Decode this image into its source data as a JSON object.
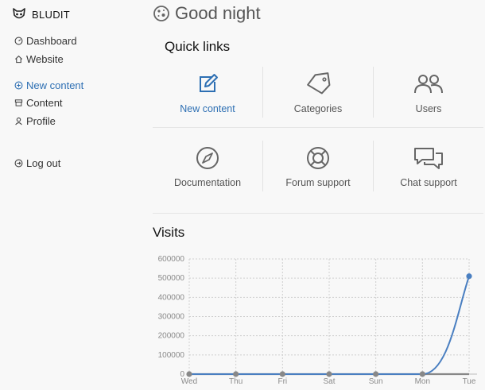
{
  "brand": {
    "name": "BLUDIT",
    "logo_icon": "bludit-logo-icon"
  },
  "sidebar": {
    "items": [
      {
        "label": "Dashboard",
        "icon": "speedometer-icon"
      },
      {
        "label": "Website",
        "icon": "home-icon"
      },
      {
        "label": "New content",
        "icon": "plus-circle-icon",
        "active": true
      },
      {
        "label": "Content",
        "icon": "archive-icon"
      },
      {
        "label": "Profile",
        "icon": "person-icon"
      },
      {
        "label": "Log out",
        "icon": "logout-icon"
      }
    ]
  },
  "greeting": {
    "text": "Good night",
    "icon": "moon-icon"
  },
  "quick_links": {
    "title": "Quick links",
    "items": [
      {
        "label": "New content",
        "icon": "pencil-square-icon"
      },
      {
        "label": "Categories",
        "icon": "tag-icon"
      },
      {
        "label": "Users",
        "icon": "users-icon"
      },
      {
        "label": "Documentation",
        "icon": "compass-icon"
      },
      {
        "label": "Forum support",
        "icon": "lifebuoy-icon"
      },
      {
        "label": "Chat support",
        "icon": "chat-icon"
      }
    ]
  },
  "visits": {
    "title": "Visits"
  },
  "colors": {
    "accent": "#2d6fb3",
    "line": "#4a7fc1",
    "point": "#888888"
  },
  "chart_data": {
    "type": "line",
    "title": "Visits",
    "categories": [
      "Wed",
      "Thu",
      "Fri",
      "Sat",
      "Sun",
      "Mon",
      "Tue"
    ],
    "series": [
      {
        "values": [
          0,
          0,
          0,
          0,
          0,
          0,
          510000
        ]
      }
    ],
    "y_ticks": [
      "0",
      "100000",
      "200000",
      "300000",
      "400000",
      "500000",
      "600000"
    ],
    "ylim": [
      0,
      600000
    ],
    "grid": true,
    "legend": "none"
  }
}
